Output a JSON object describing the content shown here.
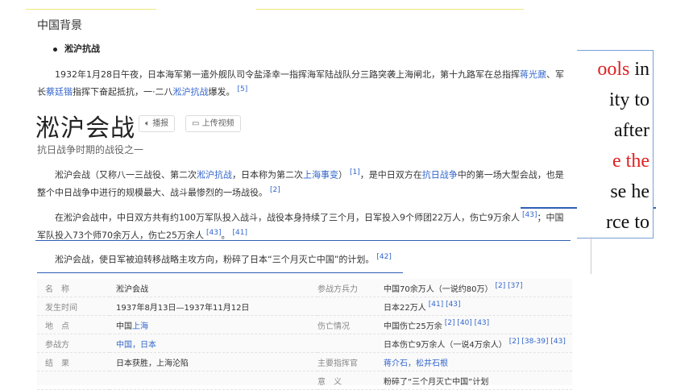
{
  "section_title": "中国背景",
  "bullet": "淞沪抗战",
  "para1": {
    "text_a": "1932年1月28日午夜，日本海军第一遣外舰队司令盐泽幸一指挥海军陆战队分三路突袭上海闸北，第十九路军在总指挥",
    "link_a": "蒋光鼐",
    "text_b": "、军长",
    "link_b": "蔡廷锴",
    "text_c": "指挥下奋起抵抗，一·二八",
    "link_c": "淞沪抗战",
    "text_d": "爆发。",
    "ref": "[5]"
  },
  "title": "淞沪会战",
  "buttons": {
    "play": "播报",
    "upload": "上传视频"
  },
  "subtitle": "抗日战争时期的战役之一",
  "para2": {
    "a": "淞沪会战（又称八一三战役、第二次",
    "l1": "淞沪抗战",
    "b": "，日本称为第二次",
    "l2": "上海事变",
    "c": "）",
    "r1": "[1]",
    "d": "，是中日双方在",
    "l3": "抗日战争",
    "e": "中的第一场大型会战，也是整个中日战争中进行的规模最大、战斗最惨烈的一场战役。",
    "r2": "[2]"
  },
  "para3": {
    "a": "在淞沪会战中，中日双方共有约100万军队投入战斗，战役本身持续了三个月，日军投入9个师团22万人，伤亡9万余人",
    "r1": "[43]",
    "b": "；中国军队投入73个师70余万人，伤亡25万余人",
    "r2": "[43]",
    "c": "。",
    "r3": "[41]"
  },
  "para4": {
    "a": "淞沪会战，使日军被迫转移战略主攻方向，粉碎了日本“三个月灭亡中国”的计划。",
    "r": "[42]"
  },
  "overlay": {
    "l1_red": "ools",
    "l1_rest": " in",
    "l2": "ity to",
    "l3": "after",
    "l4": "e the",
    "l5": "se he",
    "l6": "rce to"
  },
  "info": {
    "row1": {
      "k1": "名　称",
      "v1": "淞沪会战",
      "k2": "参战方兵力",
      "v2": "中国70余万人（一说约80万）",
      "r2": "[2] [37]"
    },
    "row2": {
      "k1": "发生时间",
      "v1": "1937年8月13日—1937年11月12日",
      "k2": "",
      "v2": "日本22万人",
      "r2": "[41] [43]"
    },
    "row3": {
      "k1": "地　点",
      "v1a": "中国",
      "v1b": "上海",
      "k2": "伤亡情况",
      "v2": "中国伤亡25万余",
      "r2": "[2] [40] [43]"
    },
    "row4": {
      "k1": "参战方",
      "v1": "中国，日本",
      "k2": "",
      "v2": "日本伤亡9万余人（一说4万余人）",
      "r2": "[2] [38-39] [43]"
    },
    "row5": {
      "k1": "结　果",
      "v1": "日本获胜，上海沦陷",
      "k2": "主要指挥官",
      "v2": "蒋介石，松井石根"
    },
    "row6": {
      "k2": "意　义",
      "v2": "粉碎了“三个月灭亡中国”计划"
    }
  }
}
